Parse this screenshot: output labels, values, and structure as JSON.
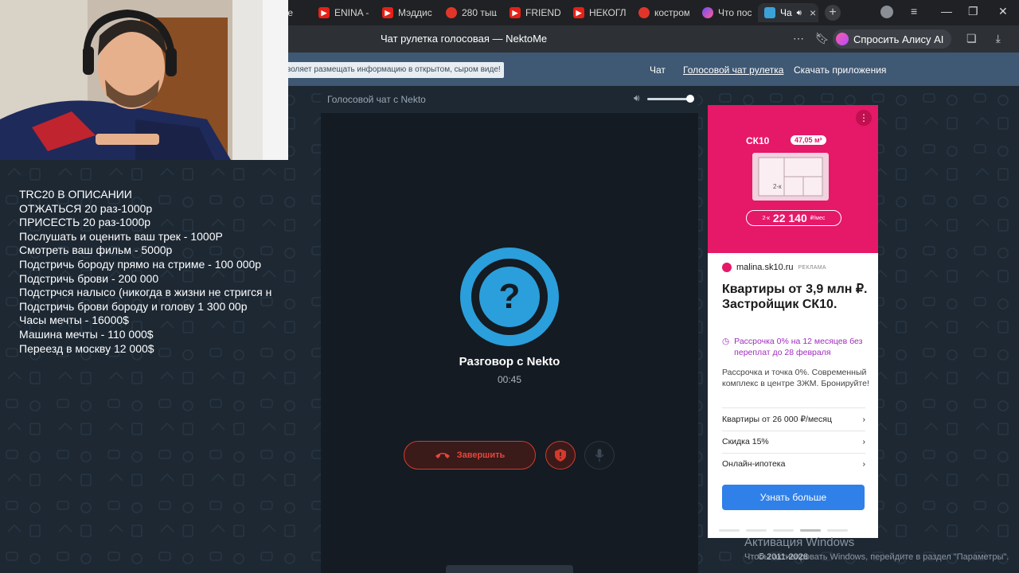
{
  "browser": {
    "tabs": [
      {
        "icon": "generic",
        "label": "ube"
      },
      {
        "icon": "youtube",
        "label": "ENINA -"
      },
      {
        "icon": "youtube",
        "label": "Мэддис"
      },
      {
        "icon": "yandex",
        "label": "280 тыщ"
      },
      {
        "icon": "youtube",
        "label": "FRIENDE"
      },
      {
        "icon": "youtube",
        "label": "НЕКОГЛ"
      },
      {
        "icon": "yandex",
        "label": "костром"
      },
      {
        "icon": "neuro",
        "label": "Что пос"
      },
      {
        "icon": "nekto",
        "label": "Ча"
      }
    ],
    "active_tab_index": 8,
    "page_title": "Чат рулетка голосовая — NektoMe",
    "alice_label": "Спросить Алису AI",
    "window_controls": [
      "≡",
      "—",
      "❐",
      "✕"
    ]
  },
  "site": {
    "warning_text": "воляет размещать информацию в открытом, сыром виде!",
    "nav": [
      "Чат",
      "Голосовой чат рулетка",
      "Скачать приложения"
    ]
  },
  "chat": {
    "header_title": "Голосовой чат с Nekto",
    "volume_level": 0.9,
    "conversation_title": "Разговор с Nekto",
    "timer": "00:45",
    "end_button_label": "Завершить",
    "avatar_glyph": "?"
  },
  "overlay_lines": [
    "TRC20 В ОПИСАНИИ",
    "ОТЖАТЬСЯ 20 раз-1000р",
    "ПРИСЕСТЬ 20 раз-1000р",
    "Послушать и оценить ваш трек - 1000Р",
    "Смотреть ваш фильм - 5000р",
    "Подстричь бороду прямо на стриме - 100 000р",
    "Подстричь брови - 200 000",
    "Подстрчся налысо (никогда в жизни не стригся н",
    "Подстричь брови бороду и голову 1 300 00р",
    "Часы мечты - 16000$",
    "Машина мечты - 110 000$",
    "Переезд в москву 12 000$"
  ],
  "ad": {
    "brand": "СК10",
    "area": "47,05 м²",
    "plan_label": "2-к",
    "price_prefix": "2-к",
    "price": "22 140",
    "price_unit": "₽/мес",
    "site": "malina.sk10.ru",
    "tag": "РЕКЛАМА",
    "headline": "Квартиры от 3,9 млн ₽. Застройщик СК10.",
    "promo": "Рассрочка 0% на 12 месяцев без переплат до 28 февраля",
    "body": "Рассрочка и точка 0%. Современный комплекс в центре ЗЖМ. Бронируйте!",
    "links": [
      "Квартиры от 26 000 ₽/месяц",
      "Скидка 15%",
      "Онлайн-ипотека"
    ],
    "cta": "Узнать больше",
    "carousel_active": 3
  },
  "footer": {
    "copyright": "© 2011-2026",
    "activation_title": "Активация Windows",
    "activation_sub": "Чтобы активировать Windows, перейдите в раздел \"Параметры\"."
  }
}
